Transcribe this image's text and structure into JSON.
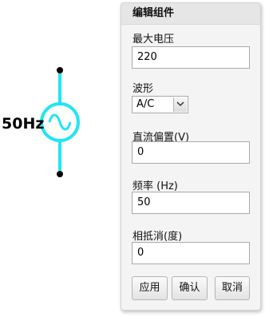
{
  "canvas": {
    "source_label": "50Hz",
    "source_color": "#22e4f4"
  },
  "panel": {
    "title": "编辑组件",
    "fields": {
      "max_voltage": {
        "label": "最大电压",
        "value": "220"
      },
      "waveform": {
        "label": "波形",
        "value": "A/C"
      },
      "dc_offset": {
        "label": "直流偏置(V)",
        "value": "0"
      },
      "frequency": {
        "label": "频率 (Hz)",
        "value": "50"
      },
      "phase": {
        "label": "相抵消(度)",
        "value": "0"
      }
    },
    "buttons": {
      "apply": "应用",
      "confirm": "确认",
      "cancel": "取消"
    }
  }
}
